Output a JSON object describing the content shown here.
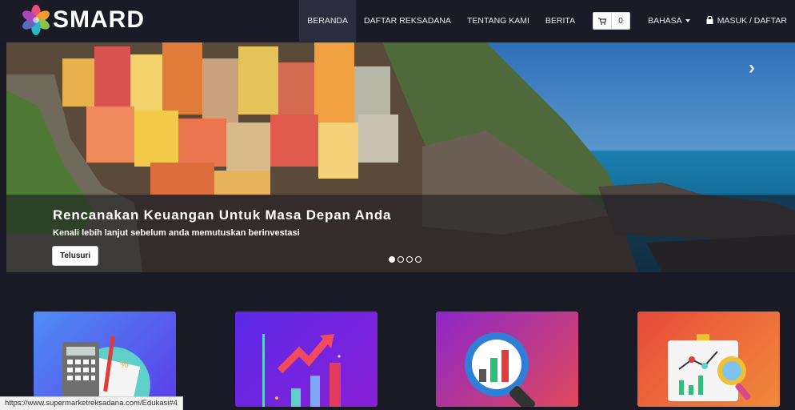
{
  "brand": {
    "name": "SMARD",
    "icon": "lotus-logo-icon"
  },
  "nav": {
    "items": [
      {
        "label": "BERANDA",
        "active": true
      },
      {
        "label": "DAFTAR REKSADANA"
      },
      {
        "label": "TENTANG KAMI"
      },
      {
        "label": "BERITA"
      }
    ],
    "cart_count": "0",
    "cart_icon": "cart-icon",
    "language_label": "BAHASA",
    "login_label": "MASUK / DAFTAR",
    "login_icon": "lock-icon"
  },
  "hero": {
    "title": "Rencanakan Keuangan Untuk Masa Depan Anda",
    "subtitle": "Kenali lebih lanjut sebelum anda memutuskan berinvestasi",
    "button_label": "Telusuri",
    "slide_count": 4,
    "active_slide": 1,
    "next_icon": "chevron-right-icon"
  },
  "cards": [
    {
      "icon": "calculator-icon",
      "color_from": "#4f8df5",
      "color_to": "#5a3de8"
    },
    {
      "icon": "growth-chart-icon",
      "color_from": "#5a2ae8",
      "color_to": "#8a1fd6"
    },
    {
      "icon": "analytics-magnifier-icon",
      "color_from": "#8c26c9",
      "color_to": "#e0485c"
    },
    {
      "icon": "presentation-board-icon",
      "color_from": "#e84a3a",
      "color_to": "#f08a3a"
    }
  ],
  "status_bar": {
    "url": "https://www.supermarketreksadana.com/Edukasi#4"
  },
  "colors": {
    "navbar": "#1a1b26",
    "page_bg": "#191a26"
  }
}
